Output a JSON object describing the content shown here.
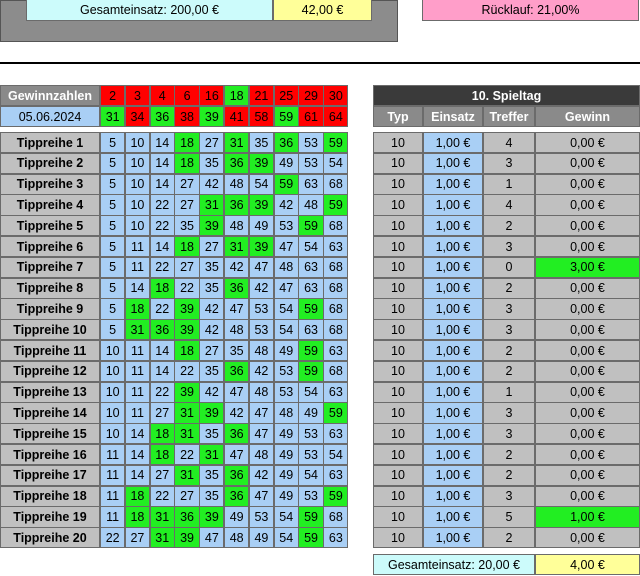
{
  "top": {
    "gesamteinsatz": "Gesamteinsatz: 200,00 €",
    "gesamtgewinn": "42,00 €",
    "ruecklauf": "Rücklauf: 21,00%"
  },
  "gewinnzahlen": {
    "label": "Gewinnzahlen",
    "date": "05.06.2024",
    "row1": [
      "2",
      "3",
      "4",
      "6",
      "16",
      "18",
      "21",
      "25",
      "29",
      "30"
    ],
    "row1_colors": [
      "red",
      "red",
      "red",
      "red",
      "red",
      "green",
      "red",
      "red",
      "red",
      "red"
    ],
    "row2": [
      "31",
      "34",
      "36",
      "38",
      "39",
      "41",
      "58",
      "59",
      "61",
      "64"
    ],
    "row2_colors": [
      "green",
      "red",
      "green",
      "red",
      "green",
      "red",
      "red",
      "green",
      "red",
      "red"
    ]
  },
  "spieltag": {
    "title": "10. Spieltag",
    "headers": [
      "Typ",
      "Einsatz",
      "Treffer",
      "Gewinn"
    ]
  },
  "rows": [
    {
      "label": "Tippreihe 1",
      "nums": [
        "5",
        "10",
        "14",
        "18",
        "27",
        "31",
        "35",
        "36",
        "53",
        "59"
      ],
      "hits": [
        3,
        5,
        7,
        9
      ],
      "typ": "10",
      "einsatz": "1,00 €",
      "treffer": "4",
      "gewinn": "0,00 €",
      "win": false
    },
    {
      "label": "Tippreihe 2",
      "nums": [
        "5",
        "10",
        "14",
        "18",
        "35",
        "36",
        "39",
        "49",
        "53",
        "54"
      ],
      "hits": [
        3,
        5,
        6
      ],
      "typ": "10",
      "einsatz": "1,00 €",
      "treffer": "3",
      "gewinn": "0,00 €",
      "win": false
    },
    {
      "label": "Tippreihe 3",
      "nums": [
        "5",
        "10",
        "14",
        "27",
        "42",
        "48",
        "54",
        "59",
        "63",
        "68"
      ],
      "hits": [
        7
      ],
      "typ": "10",
      "einsatz": "1,00 €",
      "treffer": "1",
      "gewinn": "0,00 €",
      "win": false
    },
    {
      "label": "Tippreihe 4",
      "nums": [
        "5",
        "10",
        "22",
        "27",
        "31",
        "36",
        "39",
        "42",
        "48",
        "59"
      ],
      "hits": [
        4,
        5,
        6,
        9
      ],
      "typ": "10",
      "einsatz": "1,00 €",
      "treffer": "4",
      "gewinn": "0,00 €",
      "win": false
    },
    {
      "label": "Tippreihe 5",
      "nums": [
        "5",
        "10",
        "22",
        "35",
        "39",
        "48",
        "49",
        "53",
        "59",
        "68"
      ],
      "hits": [
        4,
        8
      ],
      "typ": "10",
      "einsatz": "1,00 €",
      "treffer": "2",
      "gewinn": "0,00 €",
      "win": false
    },
    {
      "label": "Tippreihe 6",
      "nums": [
        "5",
        "11",
        "14",
        "18",
        "27",
        "31",
        "39",
        "47",
        "54",
        "63"
      ],
      "hits": [
        3,
        5,
        6
      ],
      "typ": "10",
      "einsatz": "1,00 €",
      "treffer": "3",
      "gewinn": "0,00 €",
      "win": false
    },
    {
      "label": "Tippreihe 7",
      "nums": [
        "5",
        "11",
        "22",
        "27",
        "35",
        "42",
        "47",
        "48",
        "63",
        "68"
      ],
      "hits": [],
      "typ": "10",
      "einsatz": "1,00 €",
      "treffer": "0",
      "gewinn": "3,00 €",
      "win": true
    },
    {
      "label": "Tippreihe 8",
      "nums": [
        "5",
        "14",
        "18",
        "22",
        "35",
        "36",
        "42",
        "47",
        "63",
        "68"
      ],
      "hits": [
        2,
        5
      ],
      "typ": "10",
      "einsatz": "1,00 €",
      "treffer": "2",
      "gewinn": "0,00 €",
      "win": false
    },
    {
      "label": "Tippreihe 9",
      "nums": [
        "5",
        "18",
        "22",
        "39",
        "42",
        "47",
        "53",
        "54",
        "59",
        "68"
      ],
      "hits": [
        1,
        3,
        8
      ],
      "typ": "10",
      "einsatz": "1,00 €",
      "treffer": "3",
      "gewinn": "0,00 €",
      "win": false
    },
    {
      "label": "Tippreihe 10",
      "nums": [
        "5",
        "31",
        "36",
        "39",
        "42",
        "48",
        "53",
        "54",
        "63",
        "68"
      ],
      "hits": [
        1,
        2,
        3
      ],
      "typ": "10",
      "einsatz": "1,00 €",
      "treffer": "3",
      "gewinn": "0,00 €",
      "win": false
    },
    {
      "label": "Tippreihe 11",
      "nums": [
        "10",
        "11",
        "14",
        "18",
        "27",
        "35",
        "48",
        "49",
        "59",
        "63"
      ],
      "hits": [
        3,
        8
      ],
      "typ": "10",
      "einsatz": "1,00 €",
      "treffer": "2",
      "gewinn": "0,00 €",
      "win": false
    },
    {
      "label": "Tippreihe 12",
      "nums": [
        "10",
        "11",
        "14",
        "22",
        "35",
        "36",
        "42",
        "53",
        "59",
        "68"
      ],
      "hits": [
        5,
        8
      ],
      "typ": "10",
      "einsatz": "1,00 €",
      "treffer": "2",
      "gewinn": "0,00 €",
      "win": false
    },
    {
      "label": "Tippreihe 13",
      "nums": [
        "10",
        "11",
        "22",
        "39",
        "42",
        "47",
        "48",
        "53",
        "54",
        "63"
      ],
      "hits": [
        3
      ],
      "typ": "10",
      "einsatz": "1,00 €",
      "treffer": "1",
      "gewinn": "0,00 €",
      "win": false
    },
    {
      "label": "Tippreihe 14",
      "nums": [
        "10",
        "11",
        "27",
        "31",
        "39",
        "42",
        "47",
        "48",
        "49",
        "59"
      ],
      "hits": [
        3,
        4,
        9
      ],
      "typ": "10",
      "einsatz": "1,00 €",
      "treffer": "3",
      "gewinn": "0,00 €",
      "win": false
    },
    {
      "label": "Tippreihe 15",
      "nums": [
        "10",
        "14",
        "18",
        "31",
        "35",
        "36",
        "47",
        "49",
        "53",
        "63"
      ],
      "hits": [
        2,
        3,
        5
      ],
      "typ": "10",
      "einsatz": "1,00 €",
      "treffer": "3",
      "gewinn": "0,00 €",
      "win": false
    },
    {
      "label": "Tippreihe 16",
      "nums": [
        "11",
        "14",
        "18",
        "22",
        "31",
        "47",
        "48",
        "49",
        "53",
        "54"
      ],
      "hits": [
        2,
        4
      ],
      "typ": "10",
      "einsatz": "1,00 €",
      "treffer": "2",
      "gewinn": "0,00 €",
      "win": false
    },
    {
      "label": "Tippreihe 17",
      "nums": [
        "11",
        "14",
        "27",
        "31",
        "35",
        "36",
        "42",
        "49",
        "54",
        "63"
      ],
      "hits": [
        3,
        5
      ],
      "typ": "10",
      "einsatz": "1,00 €",
      "treffer": "2",
      "gewinn": "0,00 €",
      "win": false
    },
    {
      "label": "Tippreihe 18",
      "nums": [
        "11",
        "18",
        "22",
        "27",
        "35",
        "36",
        "47",
        "49",
        "53",
        "59"
      ],
      "hits": [
        1,
        5,
        9
      ],
      "typ": "10",
      "einsatz": "1,00 €",
      "treffer": "3",
      "gewinn": "0,00 €",
      "win": false
    },
    {
      "label": "Tippreihe 19",
      "nums": [
        "11",
        "18",
        "31",
        "36",
        "39",
        "49",
        "53",
        "54",
        "59",
        "68"
      ],
      "hits": [
        1,
        2,
        3,
        4,
        8
      ],
      "typ": "10",
      "einsatz": "1,00 €",
      "treffer": "5",
      "gewinn": "1,00 €",
      "win": true
    },
    {
      "label": "Tippreihe 20",
      "nums": [
        "22",
        "27",
        "31",
        "39",
        "47",
        "48",
        "49",
        "54",
        "59",
        "63"
      ],
      "hits": [
        2,
        3,
        8
      ],
      "typ": "10",
      "einsatz": "1,00 €",
      "treffer": "2",
      "gewinn": "0,00 €",
      "win": false
    }
  ],
  "bottom": {
    "gesamteinsatz": "Gesamteinsatz: 20,00 €",
    "gewinn": "4,00 €"
  }
}
